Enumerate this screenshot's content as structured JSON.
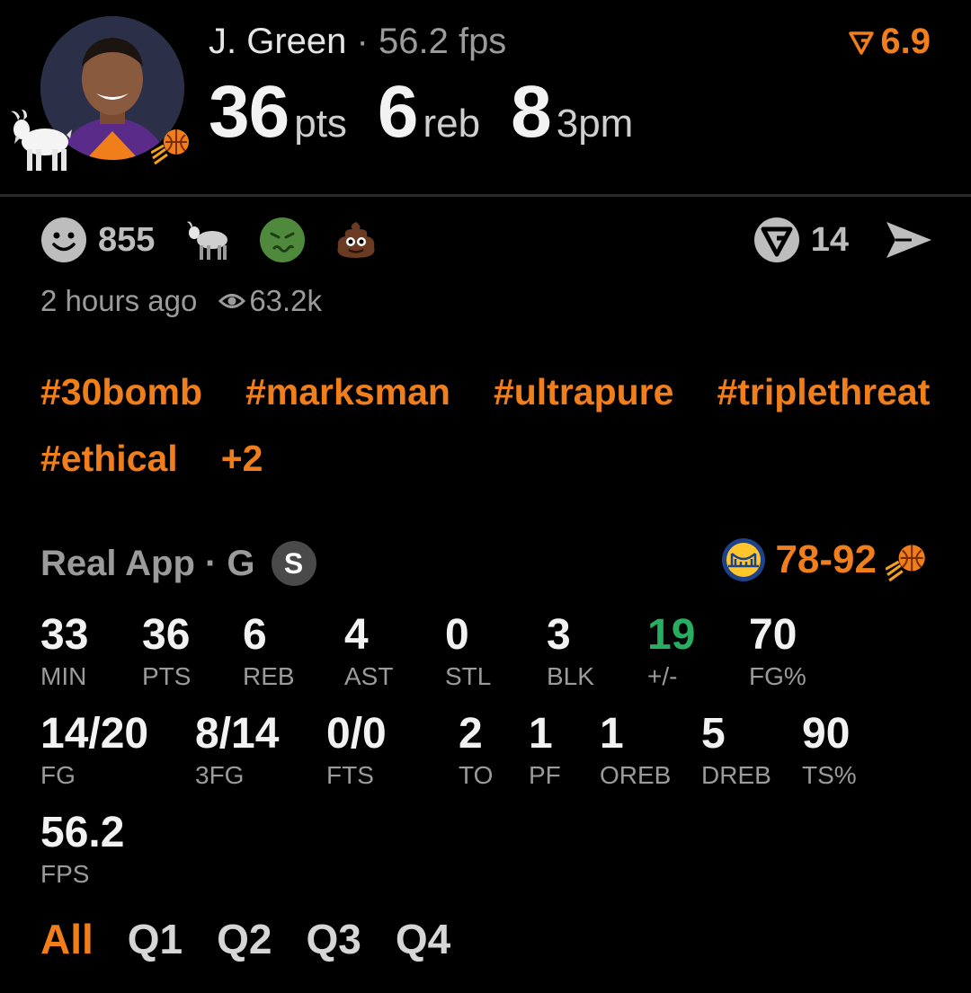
{
  "header": {
    "player_name": "J. Green",
    "separator": "·",
    "fps_text": "56.2 fps",
    "rating": "6.9",
    "headline": [
      {
        "value": "36",
        "unit": "pts"
      },
      {
        "value": "6",
        "unit": "reb"
      },
      {
        "value": "8",
        "unit": "3pm"
      }
    ]
  },
  "reactions": {
    "like_count": "855",
    "comment_count": "14"
  },
  "meta": {
    "time_ago": "2 hours ago",
    "views": "63.2k"
  },
  "tags": [
    "#30bomb",
    "#marksman",
    "#ultrapure",
    "#triplethreat",
    "#ethical",
    "+2"
  ],
  "source": {
    "text": "Real App · G",
    "badge": "S",
    "score": "78-92"
  },
  "stats": {
    "min": {
      "value": "33",
      "label": "MIN"
    },
    "pts": {
      "value": "36",
      "label": "PTS"
    },
    "reb": {
      "value": "6",
      "label": "REB"
    },
    "ast": {
      "value": "4",
      "label": "AST"
    },
    "stl": {
      "value": "0",
      "label": "STL"
    },
    "blk": {
      "value": "3",
      "label": "BLK"
    },
    "plus_minus": {
      "value": "19",
      "label": "+/-"
    },
    "fg_pct": {
      "value": "70",
      "label": "FG%"
    },
    "fg": {
      "value": "14/20",
      "label": "FG"
    },
    "three_fg": {
      "value": "8/14",
      "label": "3FG"
    },
    "fts": {
      "value": "0/0",
      "label": "FTS"
    },
    "to": {
      "value": "2",
      "label": "TO"
    },
    "pf": {
      "value": "1",
      "label": "PF"
    },
    "oreb": {
      "value": "1",
      "label": "OREB"
    },
    "dreb": {
      "value": "5",
      "label": "DREB"
    },
    "ts_pct": {
      "value": "90",
      "label": "TS%"
    },
    "fps": {
      "value": "56.2",
      "label": "FPS"
    }
  },
  "tabs": [
    "All",
    "Q1",
    "Q2",
    "Q3",
    "Q4"
  ],
  "colors": {
    "accent": "#f07e1a",
    "positive": "#27ae60",
    "muted": "#9b9b9b",
    "background": "#000000"
  }
}
